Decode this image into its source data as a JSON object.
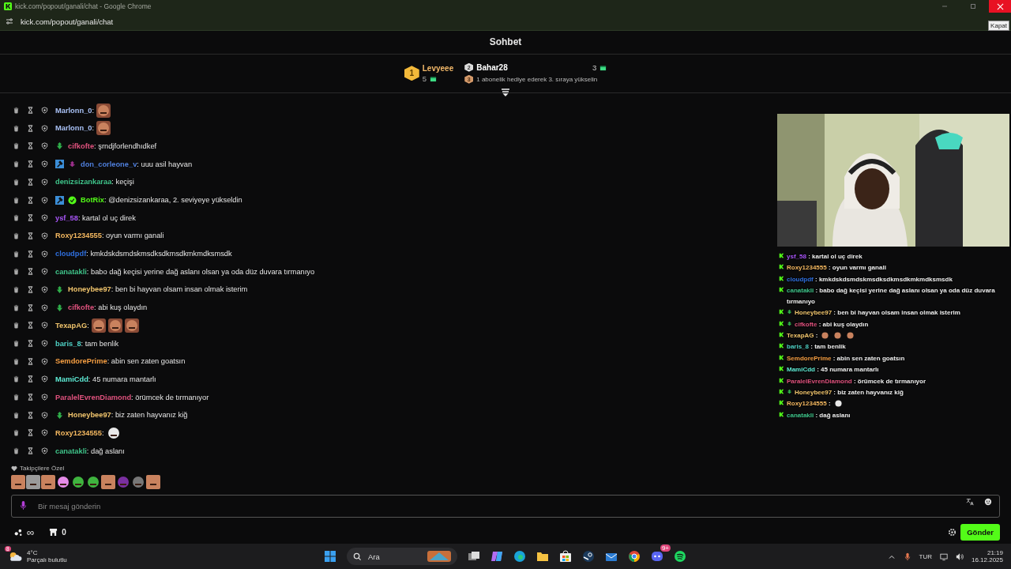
{
  "window": {
    "title": "kick.com/popout/ganali/chat - Google Chrome",
    "url": "kick.com/popout/ganali/chat",
    "tooltip": "Kapat"
  },
  "header": {
    "title": "Sohbet"
  },
  "leaderboard": {
    "first": {
      "rank": "1",
      "name": "Levyeee",
      "count": "5"
    },
    "second": {
      "rank": "2",
      "name": "Bahar28",
      "count": "3"
    },
    "hint": {
      "rank": "3",
      "text": "1 abonelik hediye ederek 3. sıraya yükselin"
    }
  },
  "messages": [
    {
      "user": "Marlonn_0",
      "color": "#a9c1f5",
      "text": ":",
      "emotes": [
        {
          "kind": "face"
        }
      ]
    },
    {
      "user": "Marlonn_0",
      "color": "#a9c1f5",
      "text": ":",
      "emotes": [
        {
          "kind": "face"
        }
      ]
    },
    {
      "user": "cifkofte",
      "color": "#e0527e",
      "badges": [
        {
          "kind": "gifter"
        }
      ],
      "text": ": şrndjforlendhıdkef"
    },
    {
      "user": "don_corleone_v",
      "color": "#4f7fdc",
      "badges": [
        {
          "kind": "moderator"
        },
        {
          "kind": "sub"
        }
      ],
      "text": ": uuu asil hayvan"
    },
    {
      "user": "denizsizankaraa",
      "color": "#3fc48a",
      "text": ": keçişi"
    },
    {
      "user": "BotRix",
      "color": "#53fc18",
      "badges": [
        {
          "kind": "moderator"
        },
        {
          "kind": "verified"
        }
      ],
      "text": ": @denizsizankaraa, 2. seviyeye yükseldin"
    },
    {
      "user": "ysf_58",
      "color": "#a855f7",
      "text": ": kartal ol uç direk"
    },
    {
      "user": "Roxy1234555",
      "color": "#f4b860",
      "text": ": oyun varmı ganali"
    },
    {
      "user": "cloudpdf",
      "color": "#2f6fde",
      "text": ": kmkdskdsmdskmsdksdkmsdkmkmdksmsdk"
    },
    {
      "user": "canatakli",
      "color": "#3fc48a",
      "text": ": babo dağ keçisi yerine dağ aslanı olsan ya oda düz duvara tırmanıyo"
    },
    {
      "user": "Honeybee97",
      "color": "#f0c46c",
      "badges": [
        {
          "kind": "gifter"
        }
      ],
      "text": ": ben bi hayvan olsam insan olmak isterim"
    },
    {
      "user": "cifkofte",
      "color": "#e0527e",
      "badges": [
        {
          "kind": "gifter"
        }
      ],
      "text": ": abi kuş olaydın"
    },
    {
      "user": "TexapAG",
      "color": "#f0c46c",
      "text": ":",
      "emotes": [
        {
          "kind": "face"
        },
        {
          "kind": "face"
        },
        {
          "kind": "face"
        }
      ]
    },
    {
      "user": "baris_8",
      "color": "#4fd1c5",
      "text": ": tam benlik"
    },
    {
      "user": "SemdorePrime",
      "color": "#f59e42",
      "text": ": abin sen zaten goatsın"
    },
    {
      "user": "MamiCdd",
      "color": "#5eead4",
      "text": ": 45 numara mantarlı"
    },
    {
      "user": "ParalelEvrenDiamond",
      "color": "#e0527e",
      "text": ": örümcek de tırmanıyor"
    },
    {
      "user": "Honeybee97",
      "color": "#f0c46c",
      "badges": [
        {
          "kind": "gifter"
        }
      ],
      "text": ": biz zaten hayvanız kiğ"
    },
    {
      "user": "Roxy1234555",
      "color": "#f4b860",
      "text": ":",
      "emotes": [
        {
          "kind": "ghost"
        }
      ]
    },
    {
      "user": "canatakli",
      "color": "#3fc48a",
      "text": ": dağ aslanı"
    }
  ],
  "stream_overlay": {
    "messages": [
      {
        "user": "ysf_58",
        "color": "#a855f7",
        "gifter": false,
        "text": " : kartal ol uç direk"
      },
      {
        "user": "Roxy1234555",
        "color": "#f4b860",
        "gifter": false,
        "text": " : oyun varmı ganali"
      },
      {
        "user": "cloudpdf",
        "color": "#2f6fde",
        "gifter": false,
        "text": " : kmkdskdsmdskmsdksdkmsdkmkmdksmsdk"
      },
      {
        "user": "canatakli",
        "color": "#3fc48a",
        "gifter": false,
        "text": " : babo dağ keçisi yerine dağ aslanı olsan ya oda düz duvara tırmanıyo"
      },
      {
        "user": "Honeybee97",
        "color": "#f0c46c",
        "gifter": true,
        "text": " : ben bi hayvan olsam insan olmak isterim"
      },
      {
        "user": "cifkofte",
        "color": "#e0527e",
        "gifter": true,
        "text": " : abi kuş olaydın"
      },
      {
        "user": "TexapAG",
        "color": "#f0c46c",
        "gifter": false,
        "text": " :",
        "emotes": [
          {
            "kind": "face"
          },
          {
            "kind": "face"
          },
          {
            "kind": "face"
          }
        ]
      },
      {
        "user": "baris_8",
        "color": "#4fd1c5",
        "gifter": false,
        "text": " : tam benlik"
      },
      {
        "user": "SemdorePrime",
        "color": "#f59e42",
        "gifter": false,
        "text": " : abin sen zaten goatsın"
      },
      {
        "user": "MamiCdd",
        "color": "#5eead4",
        "gifter": false,
        "text": " : 45 numara mantarlı"
      },
      {
        "user": "ParalelEvrenDiamond",
        "color": "#e0527e",
        "gifter": false,
        "text": " : örümcek de tırmanıyor"
      },
      {
        "user": "Honeybee97",
        "color": "#f0c46c",
        "gifter": true,
        "text": " : biz zaten hayvanız kiğ"
      },
      {
        "user": "Roxy1234555",
        "color": "#f4b860",
        "gifter": false,
        "text": " :",
        "emotes": [
          {
            "kind": "ghost"
          }
        ]
      },
      {
        "user": "canatakli",
        "color": "#3fc48a",
        "gifter": false,
        "text": " : dağ aslanı"
      }
    ]
  },
  "emote_bar": {
    "title": "Takipçilere Özel",
    "emotes": [
      {
        "kind": "face"
      },
      {
        "kind": "cat"
      },
      {
        "kind": "face"
      },
      {
        "kind": "heart"
      },
      {
        "kind": "blob"
      },
      {
        "kind": "blob"
      },
      {
        "kind": "face"
      },
      {
        "kind": "demon"
      },
      {
        "kind": "stick"
      },
      {
        "kind": "face"
      }
    ]
  },
  "composer": {
    "placeholder": "Bir mesaj gönderin",
    "send": "Gönder",
    "infinity": "∞",
    "points": "0"
  },
  "taskbar": {
    "temperature": "4°C",
    "weather": "Parçalı bulutlu",
    "weather_badge": "8",
    "search": "Ara",
    "discord_badge": "9+",
    "language": "TUR",
    "time": "21:19",
    "date": "16.12.2025"
  }
}
